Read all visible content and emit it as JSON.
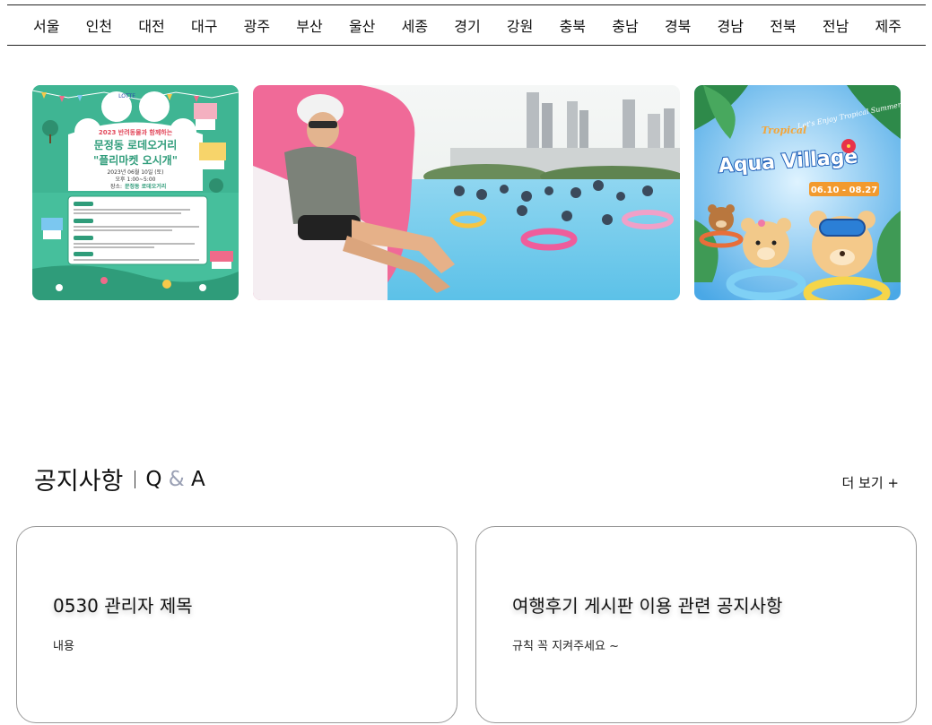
{
  "nav": {
    "regions": [
      "서울",
      "인천",
      "대전",
      "대구",
      "광주",
      "부산",
      "울산",
      "세종",
      "경기",
      "강원",
      "충북",
      "충남",
      "경북",
      "경남",
      "전북",
      "전남",
      "제주"
    ]
  },
  "banners": [
    {
      "logo": "LOTTE",
      "headline": "2023 반려동물과 함께하는",
      "title_line1": "문정동 로데오거리",
      "title_line2": "\"플리마켓 오시개\"",
      "date": "2023년 06월 10일 (토)",
      "time": "오후 1:00~5:00",
      "place_label": "장소:",
      "place": "문정동 로데오거리"
    },
    {},
    {
      "brand_top": "Tropical",
      "brand_main": "Aqua Village",
      "slogan": "Let's Enjoy Tropical Summer!",
      "dates": "06.10 - 08.27"
    }
  ],
  "section": {
    "title": "공지사항",
    "qna_left": "Q",
    "qna_amp": "&",
    "qna_right": "A",
    "more": "더 보기 +"
  },
  "notices": [
    {
      "title": "0530 관리자 제목",
      "body": "내용"
    },
    {
      "title": "여행후기 게시판 이용 관련 공지사항",
      "body": "규칙 꼭 지켜주세요 ~"
    }
  ],
  "colors": {
    "poster_green": "#3dbb98",
    "pool_blue": "#7fd3f0",
    "aqua_blue": "#2a8fd8"
  }
}
